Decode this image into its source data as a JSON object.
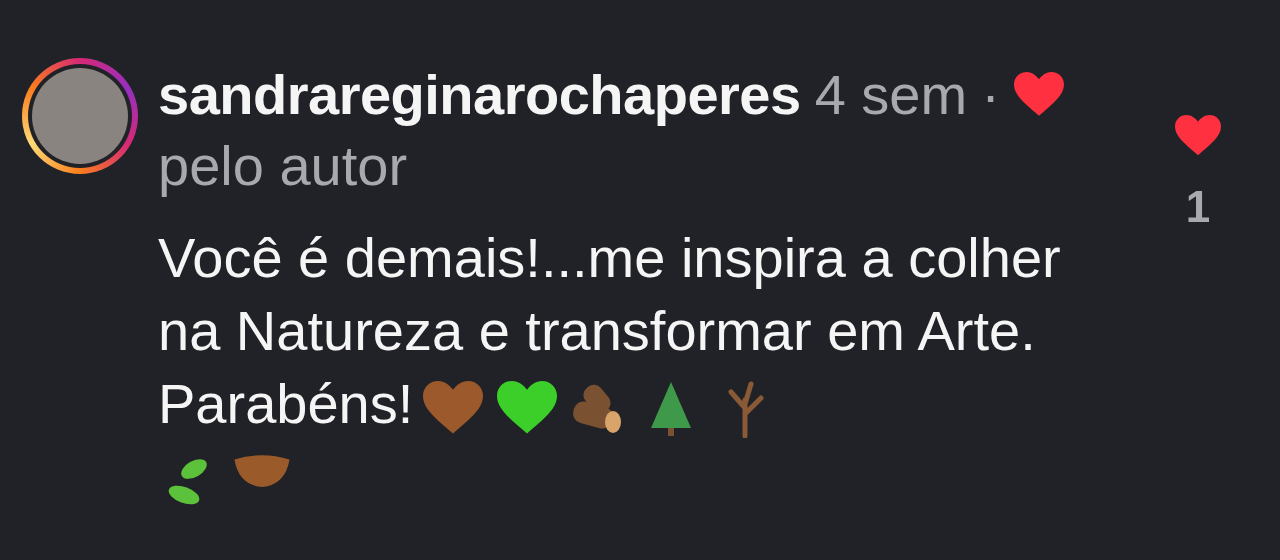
{
  "comment": {
    "username": "sandrareginarochaperes",
    "time": "4 sem",
    "separator": "·",
    "author_liked": true,
    "author_label": "pelo autor",
    "text": "Você é demais!...me inspira a colher na Natureza e transformar em Arte. Parabéns!"
  },
  "like": {
    "liked": true,
    "count": "1"
  }
}
